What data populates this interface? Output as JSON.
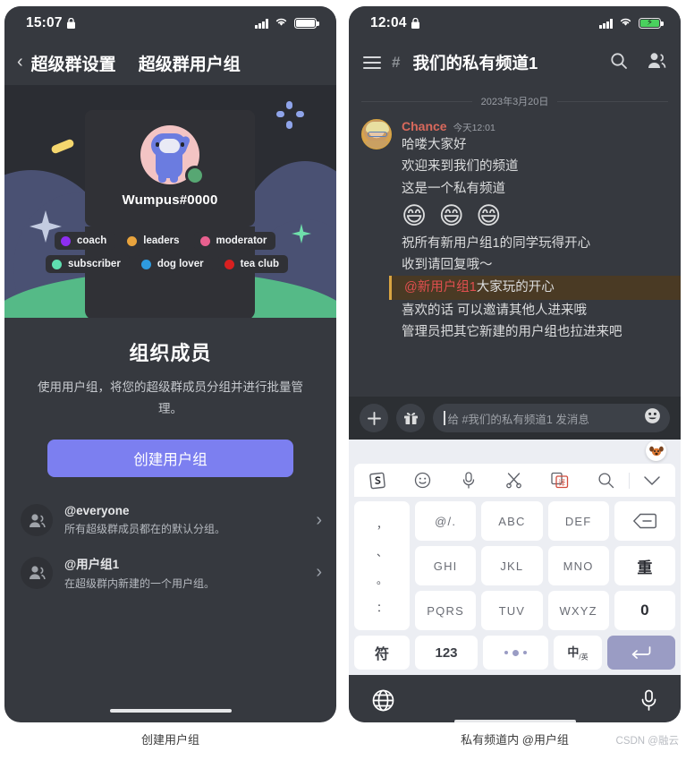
{
  "left_phone": {
    "status_bar": {
      "time": "15:07",
      "lock_icon": "lock-icon",
      "signal_icon": "signal-icon",
      "wifi_icon": "wifi-icon",
      "battery_icon": "battery-icon"
    },
    "nav": {
      "back_icon": "chevron-left-icon",
      "back_label": "超级群设置",
      "title": "超级群用户组"
    },
    "hero": {
      "username": "Wumpus#0000",
      "avatar_icon": "wumpus-avatar",
      "status_icon": "online-status-dot",
      "badges": [
        {
          "label": "coach",
          "color": "#8d2ef0"
        },
        {
          "label": "leaders",
          "color": "#e8a33d"
        },
        {
          "label": "moderator",
          "color": "#e8608f"
        },
        {
          "label": "subscriber",
          "color": "#5fdfb0"
        },
        {
          "label": "dog lover",
          "color": "#2e9bdf"
        },
        {
          "label": "tea club",
          "color": "#d82020"
        }
      ],
      "deco": {
        "pill": "yellow-pill-shape",
        "star": "grey-star-shape",
        "sparkle": "green-sparkle-shape",
        "dots": "blue-dots-shape"
      }
    },
    "promo": {
      "title": "组织成员",
      "description": "使用用户组，将您的超级群成员分组并进行批量管理。",
      "cta_label": "创建用户组",
      "cta_color": "#7c7ff0"
    },
    "groups": [
      {
        "icon": "group-avatar-icon",
        "name": "@everyone",
        "desc": "所有超级群成员都在的默认分组。",
        "chevron": "chevron-right-icon"
      },
      {
        "icon": "group-avatar-icon",
        "name": "@用户组1",
        "desc": "在超级群内新建的一个用户组。",
        "chevron": "chevron-right-icon"
      }
    ]
  },
  "right_phone": {
    "status_bar": {
      "time": "12:04",
      "lock_icon": "lock-icon",
      "signal_icon": "signal-icon",
      "wifi_icon": "wifi-icon",
      "battery_icon": "battery-charging-icon"
    },
    "header": {
      "menu_icon": "hamburger-menu-icon",
      "channel_prefix": "#",
      "channel_name": "我们的私有频道1",
      "search_icon": "search-icon",
      "members_icon": "members-icon"
    },
    "chat": {
      "date_divider": "2023年3月20日",
      "message": {
        "author": "Chance",
        "author_color": "#d9695c",
        "timestamp": "今天12:01",
        "avatar_icon": "user-avatar-chance",
        "lines": [
          {
            "type": "text",
            "text": "哈喽大家好"
          },
          {
            "type": "text",
            "text": "欢迎来到我们的频道"
          },
          {
            "type": "text",
            "text": "这是一个私有频道"
          },
          {
            "type": "emoji",
            "text": "😄 😄 😄"
          },
          {
            "type": "text",
            "text": "祝所有新用户组1的同学玩得开心"
          },
          {
            "type": "text",
            "text": "收到请回复哦～"
          },
          {
            "type": "mention",
            "mention": "@新用户组1",
            "text": "大家玩的开心"
          },
          {
            "type": "text",
            "text": "喜欢的话 可以邀请其他人进来哦"
          },
          {
            "type": "text",
            "text": "管理员把其它新建的用户组也拉进来吧"
          }
        ]
      }
    },
    "input_bar": {
      "add_icon": "plus-icon",
      "gift_icon": "gift-icon",
      "placeholder": "给 #我们的私有频道1 发消息",
      "emoji_icon": "emoji-icon"
    },
    "ime": {
      "logo_icon": "sogou-dog-logo-icon",
      "toolbar": [
        "sogou-logo-icon",
        "emoji-icon",
        "mic-icon",
        "scissors-icon",
        "translate-icon",
        "search-icon",
        "collapse-icon"
      ],
      "punctuation": [
        "，",
        "、",
        "。",
        "："
      ],
      "keys": [
        "@/.",
        "ABC",
        "DEF",
        "backspace-icon",
        "GHI",
        "JKL",
        "MNO",
        "重",
        "PQRS",
        "TUV",
        "WXYZ",
        "0"
      ],
      "bottom_row": [
        {
          "label": "符",
          "name": "symbol-key"
        },
        {
          "label": "123",
          "name": "numeric-key"
        },
        {
          "label": "",
          "name": "space-key"
        },
        {
          "label": "中/英",
          "name": "language-toggle-key"
        },
        {
          "label": "",
          "name": "enter-key"
        }
      ],
      "enter_color": "#9a9cc4"
    },
    "system_bar": {
      "globe_icon": "globe-icon",
      "mic_icon": "mic-icon",
      "home_indicator": "home-indicator"
    }
  },
  "captions": {
    "left": "创建用户组",
    "right": "私有频道内 @用户组",
    "watermark": "CSDN @融云"
  }
}
